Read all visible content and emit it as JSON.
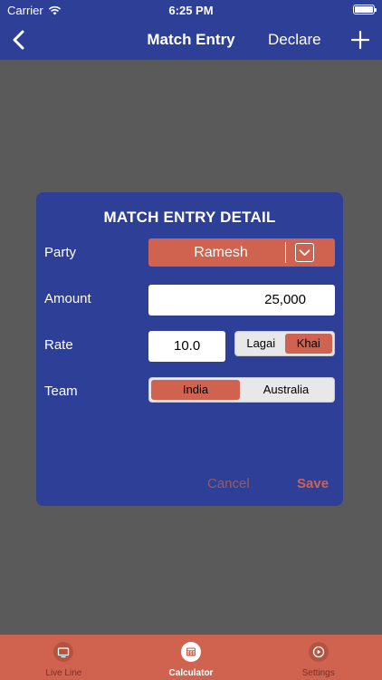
{
  "status_bar": {
    "carrier": "Carrier",
    "time": "6:25 PM"
  },
  "nav": {
    "title": "Match Entry",
    "declare_label": "Declare"
  },
  "dialog": {
    "title": "MATCH ENTRY DETAIL",
    "party": {
      "label": "Party",
      "value": "Ramesh"
    },
    "amount": {
      "label": "Amount",
      "value": "25,000"
    },
    "rate": {
      "label": "Rate",
      "value": "10.0",
      "options": [
        "Lagai",
        "Khai"
      ],
      "selected": "Khai"
    },
    "team": {
      "label": "Team",
      "options": [
        "India",
        "Australia"
      ],
      "selected": "India"
    },
    "cancel_label": "Cancel",
    "save_label": "Save"
  },
  "tabbar": {
    "items": [
      {
        "label": "Live Line",
        "icon": "tv-icon"
      },
      {
        "label": "Calculator",
        "icon": "calculator-icon"
      },
      {
        "label": "Settings",
        "icon": "settings-icon"
      }
    ],
    "active": "Calculator"
  },
  "colors": {
    "nav_bg": "#2d3f97",
    "accent": "#d0634f",
    "overlay": "#5a5a5a"
  }
}
